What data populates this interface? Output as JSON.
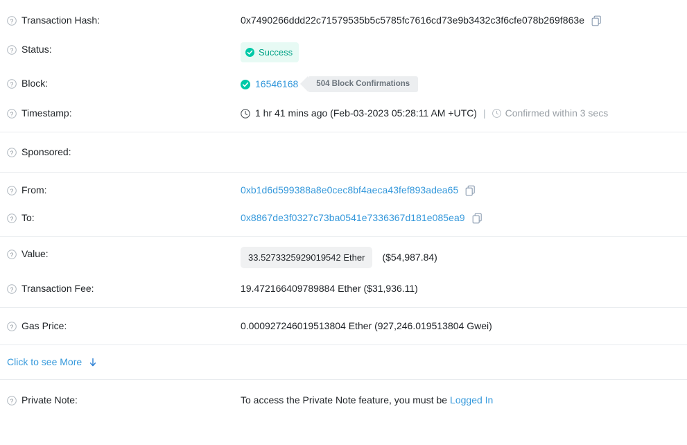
{
  "rows": {
    "tx_hash": {
      "label": "Transaction Hash:",
      "value": "0x7490266ddd22c71579535b5c5785fc7616cd73e9b3432c3f6cfe078b269f863e",
      "copy_icon": "copy-icon"
    },
    "status": {
      "label": "Status:",
      "badge_text": "Success",
      "badge_icon": "check-circle-icon",
      "badge_bg": "#e7faf4",
      "badge_color": "#00a186"
    },
    "block": {
      "label": "Block:",
      "check_icon": "check-circle-icon",
      "number": "16546168",
      "confirmations": "504 Block Confirmations"
    },
    "timestamp": {
      "label": "Timestamp:",
      "clock_icon": "clock-icon",
      "value": "1 hr 41 mins ago (Feb-03-2023 05:28:11 AM +UTC)",
      "separator": "|",
      "info_icon": "info-circle-icon",
      "confirmed": "Confirmed within 3 secs"
    },
    "sponsored": {
      "label": "Sponsored:"
    },
    "from": {
      "label": "From:",
      "value": "0xb1d6d599388a8e0cec8bf4aeca43fef893adea65",
      "copy_icon": "copy-icon"
    },
    "to": {
      "label": "To:",
      "value": "0x8867de3f0327c73ba0541e7336367d181e085ea9",
      "copy_icon": "copy-icon"
    },
    "value": {
      "label": "Value:",
      "ether": "33.5273325929019542 Ether",
      "usd": "($54,987.84)"
    },
    "txn_fee": {
      "label": "Transaction Fee:",
      "value": "19.472166409789884 Ether ($31,936.11)"
    },
    "gas_price": {
      "label": "Gas Price:",
      "value": "0.000927246019513804 Ether (927,246.019513804 Gwei)"
    },
    "see_more": {
      "label": "Click to see More",
      "arrow_icon": "arrow-down-icon"
    },
    "private_note": {
      "label": "Private Note:",
      "text": "To access the Private Note feature, you must be",
      "link": "Logged In"
    }
  },
  "colors": {
    "link": "#3498db",
    "success": "#00a186",
    "muted": "#9aa0a6",
    "divider": "#e9ecef",
    "text": "#212529"
  }
}
